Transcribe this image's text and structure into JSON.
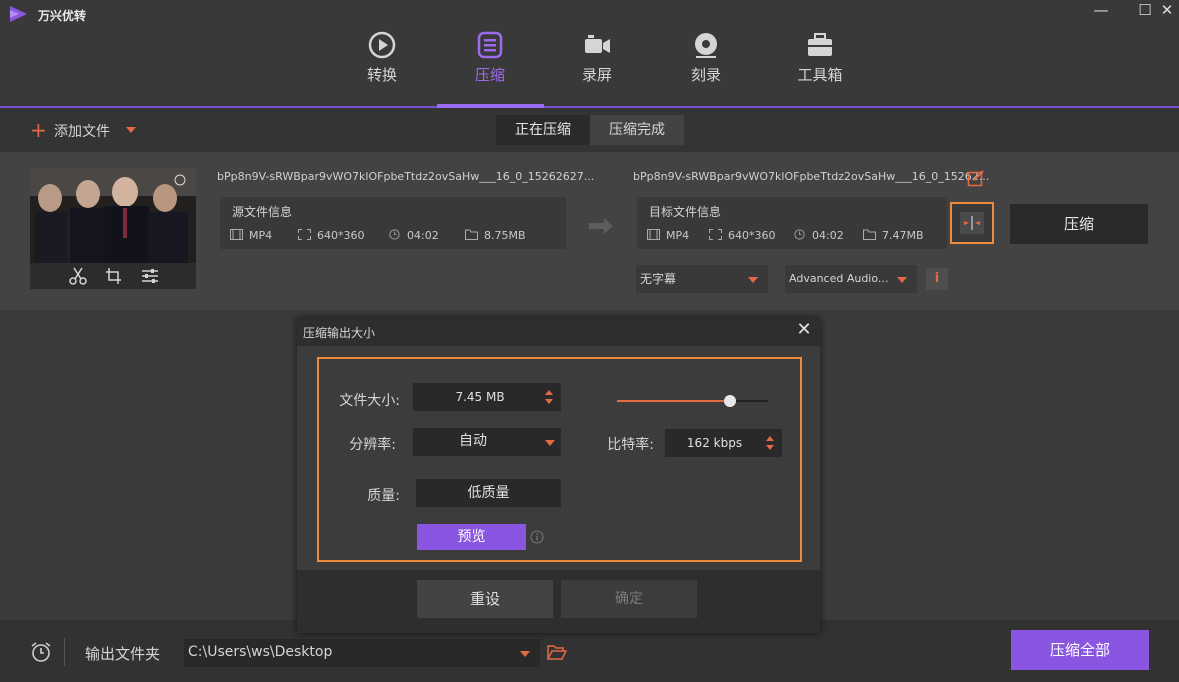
{
  "app": {
    "title": "万兴优转",
    "colors": {
      "accent": "#8a55e0",
      "highlight": "#f08a3c",
      "icon_orange": "#e46a45"
    }
  },
  "window": {
    "minimize": "—",
    "maximize": "☐",
    "close": "✕"
  },
  "nav": {
    "tabs": [
      {
        "label": "转换",
        "icon": "play-circle-icon"
      },
      {
        "label": "压缩",
        "icon": "compress-icon",
        "active": true
      },
      {
        "label": "录屏",
        "icon": "camera-icon"
      },
      {
        "label": "刻录",
        "icon": "disc-icon"
      },
      {
        "label": "工具箱",
        "icon": "toolbox-icon"
      }
    ]
  },
  "toolbar": {
    "add_plus": "+",
    "add_label": "添加文件",
    "subtabs": [
      "正在压缩",
      "压缩完成"
    ]
  },
  "file": {
    "source": {
      "name": "bPp8n9V-sRWBpar9vWO7klOFpbeTtdz2ovSaHw___16_0_15262627...",
      "title": "源文件信息",
      "format": "MP4",
      "resolution": "640*360",
      "duration": "04:02",
      "size": "8.75MB"
    },
    "target": {
      "name": "bPp8n9V-sRWBpar9vWO7klOFpbeTtdz2ovSaHw___16_0_15262...",
      "title": "目标文件信息",
      "format": "MP4",
      "resolution": "640*360",
      "duration": "04:02",
      "size": "7.47MB"
    },
    "compress_button": "压缩",
    "subtitle_option": "无字幕",
    "audio_option": "Advanced Audio...",
    "info_button": "i"
  },
  "bottom": {
    "output_label": "输出文件夹",
    "output_path": "C:\\Users\\ws\\Desktop",
    "compress_all": "压缩全部"
  },
  "dialog": {
    "title": "压缩输出大小",
    "close": "✕",
    "size_label": "文件大小:",
    "size_value": "7.45  MB",
    "slider_level": 0.75,
    "resolution_label": "分辨率:",
    "resolution_value": "自动",
    "bitrate_label": "比特率:",
    "bitrate_value": "162  kbps",
    "quality_label": "质量:",
    "quality_value": "低质量",
    "preview_button": "预览",
    "reset_button": "重设",
    "confirm_button": "确定"
  }
}
